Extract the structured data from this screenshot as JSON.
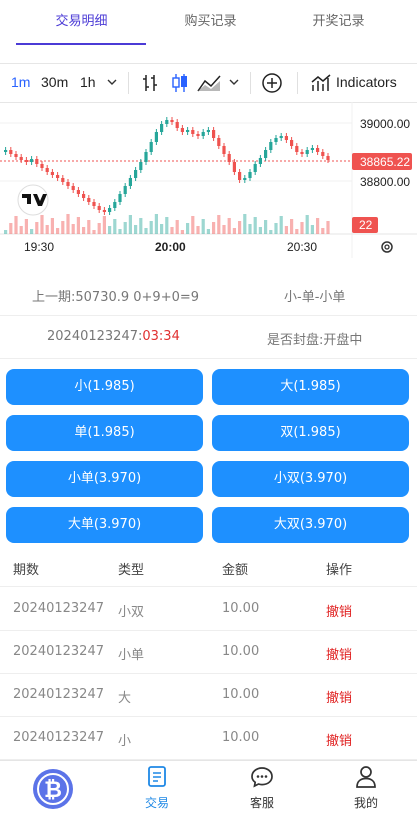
{
  "tabs": [
    {
      "label": "交易明细",
      "active": true
    },
    {
      "label": "购买记录"
    },
    {
      "label": "开奖记录"
    }
  ],
  "toolbar": {
    "intervals": [
      "1m",
      "30m",
      "1h"
    ],
    "active_interval": "1m",
    "indicators_label": "Indicators"
  },
  "chart": {
    "price_labels": [
      "39000.00",
      "38865.22",
      "38800.00"
    ],
    "current_price": "38865.22",
    "volume_label": "22",
    "time_labels": [
      "19:30",
      "20:00",
      "20:30"
    ],
    "up_color": "#26a69a",
    "down_color": "#ef5350"
  },
  "info": {
    "last_period_label": "上一期:50730.9 0+9+0=9",
    "last_result": "小-单-小单",
    "current_period": "20240123247:",
    "countdown": "03:34",
    "status": "是否封盘:开盘中"
  },
  "bets": [
    {
      "label": "小(1.985)"
    },
    {
      "label": "大(1.985)"
    },
    {
      "label": "单(1.985)"
    },
    {
      "label": "双(1.985)"
    },
    {
      "label": "小单(3.970)"
    },
    {
      "label": "小双(3.970)"
    },
    {
      "label": "大单(3.970)"
    },
    {
      "label": "大双(3.970)"
    }
  ],
  "table": {
    "headers": [
      "期数",
      "类型",
      "金额",
      "操作"
    ],
    "rows": [
      {
        "period": "20240123247",
        "type": "小双",
        "amount": "10.00",
        "action": "撤销"
      },
      {
        "period": "20240123247",
        "type": "小单",
        "amount": "10.00",
        "action": "撤销"
      },
      {
        "period": "20240123247",
        "type": "大",
        "amount": "10.00",
        "action": "撤销"
      },
      {
        "period": "20240123247",
        "type": "小",
        "amount": "10.00",
        "action": "撤销"
      }
    ]
  },
  "nav": [
    {
      "label": "",
      "icon": "bitcoin-icon"
    },
    {
      "label": "交易",
      "icon": "receipt-icon",
      "active": true
    },
    {
      "label": "客服",
      "icon": "chat-icon"
    },
    {
      "label": "我的",
      "icon": "user-icon"
    }
  ]
}
